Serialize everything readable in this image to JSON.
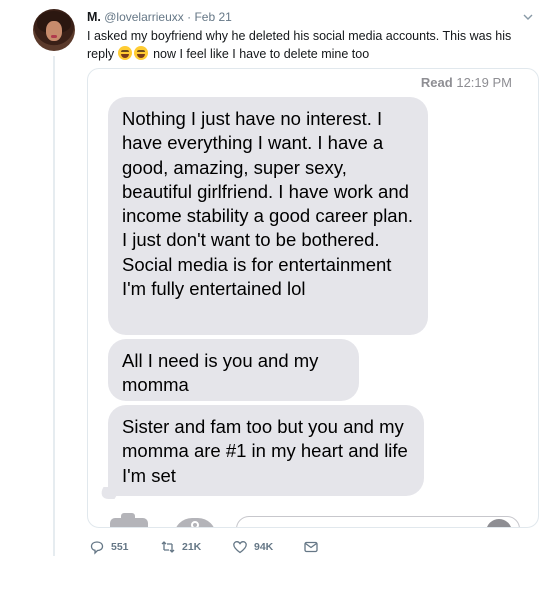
{
  "tweet": {
    "display_name": "M.",
    "handle": "@lovelarrieuxx",
    "separator": "·",
    "date": "Feb 21",
    "text_line1": "I asked my boyfriend why he deleted his social media accounts. This was his",
    "text_line2_start": "reply",
    "text_line2_end": "now I feel like I have to delete mine too",
    "emojis": [
      "weary-face",
      "weary-face"
    ]
  },
  "screenshot": {
    "read_label": "Read",
    "read_time": "12:19 PM",
    "messages": [
      "Nothing I just have no interest. I have everything I want. I have a good, amazing, super sexy, beautiful girlfriend. I have work and income stability a good career plan. I just don't want to be bothered. Social media is for entertainment I'm fully entertained lol",
      "All I need is you and my momma",
      "Sister and fam too but you and my momma are #1 in my heart and life I'm set"
    ],
    "bubble_color": "#e5e5ea"
  },
  "actions": {
    "replies": "551",
    "retweets": "21K",
    "likes": "94K"
  },
  "colors": {
    "text": "#14171a",
    "secondary": "#657786",
    "divider": "#e6ecf0"
  }
}
